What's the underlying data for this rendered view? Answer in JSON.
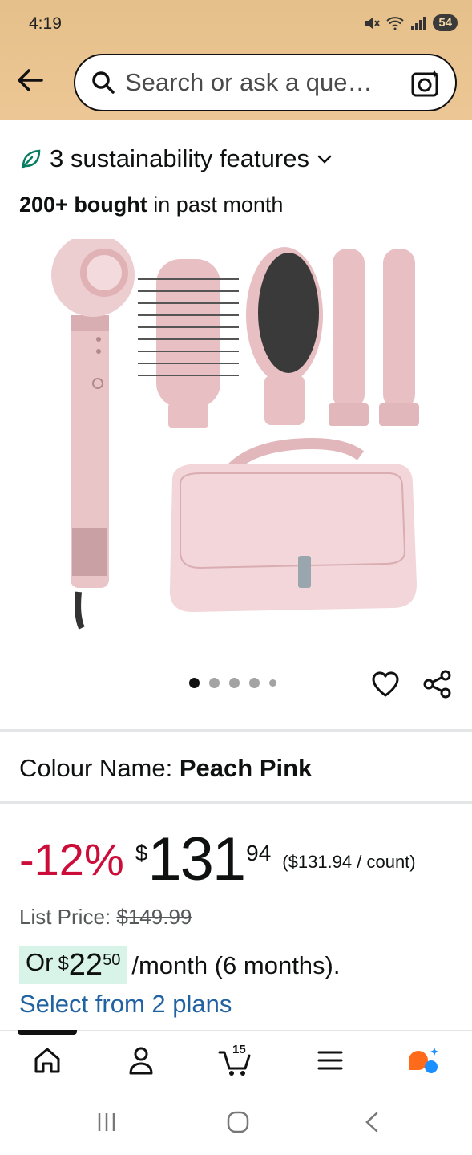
{
  "status_bar": {
    "time": "4:19",
    "battery": "54"
  },
  "search": {
    "placeholder": "Search or ask a que…"
  },
  "sustainability": {
    "label": "3 sustainability features"
  },
  "bought": {
    "bold": "200+ bought",
    "rest": " in past month"
  },
  "gallery": {
    "image_count": 5,
    "active_index": 0
  },
  "colour": {
    "label": "Colour Name:",
    "value": "Peach Pink"
  },
  "price": {
    "discount": "-12%",
    "symbol": "$",
    "whole": "131",
    "fraction": "94",
    "unit_price": "($131.94 / count)"
  },
  "list_price": {
    "label": "List Price: ",
    "value": "$149.99"
  },
  "emi": {
    "or": "Or",
    "symbol": "$",
    "whole": "22",
    "fraction": "50",
    "text": "/month (6 months)."
  },
  "plans": {
    "link": "Select from 2 plans"
  },
  "nav": {
    "cart_count": "15"
  },
  "colors": {
    "header_bg": "#ecc795",
    "discount_red": "#cc0c39",
    "link_blue": "#2162a1",
    "emi_badge": "#d8f3e7",
    "leaf_green": "#067d62",
    "rufus_orange": "#ff6b1a",
    "rufus_blue": "#1a8fff"
  },
  "icons": [
    "back-arrow-icon",
    "search-icon",
    "camera-icon",
    "leaf-icon",
    "chevron-down-icon",
    "heart-icon",
    "share-icon",
    "home-icon",
    "account-icon",
    "cart-icon",
    "menu-icon",
    "rufus-ai-icon",
    "recents-icon",
    "home-circle-icon",
    "back-chevron-icon"
  ]
}
